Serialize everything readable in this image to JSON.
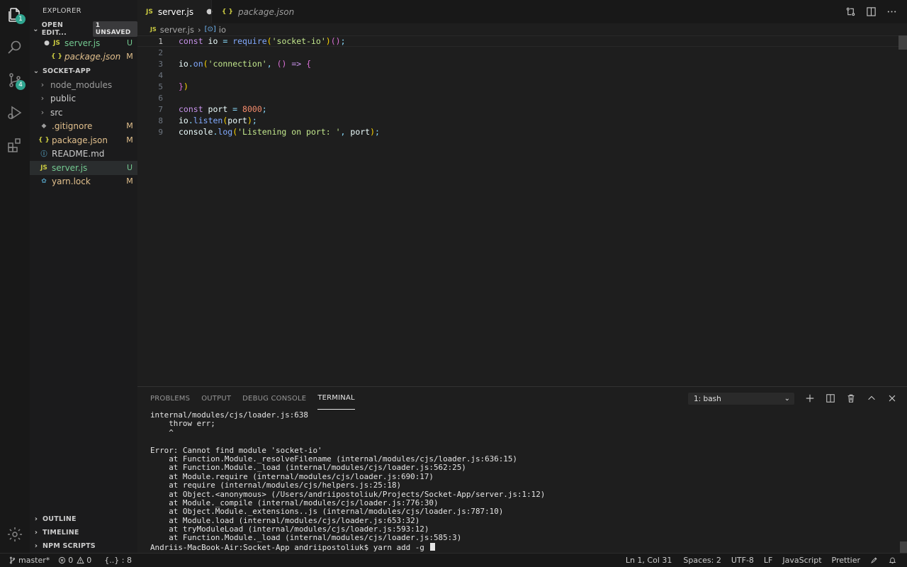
{
  "activity": {
    "explorer_badge": "1",
    "scm_badge": "4"
  },
  "sidebar": {
    "title": "EXPLORER",
    "open_editors": {
      "label": "OPEN EDIT...",
      "unsaved": "1 UNSAVED",
      "items": [
        {
          "icon": "JS",
          "name": "server.js",
          "status": "U"
        },
        {
          "icon": "{ }",
          "name": "package.json",
          "status": "M"
        }
      ]
    },
    "project": {
      "label": "SOCKET-APP",
      "items": [
        {
          "name": "node_modules",
          "status": ""
        },
        {
          "name": "public",
          "status": ""
        },
        {
          "name": "src",
          "status": ""
        },
        {
          "name": ".gitignore",
          "status": "M"
        },
        {
          "name": "package.json",
          "status": "M"
        },
        {
          "name": "README.md",
          "status": ""
        },
        {
          "name": "server.js",
          "status": "U"
        },
        {
          "name": "yarn.lock",
          "status": "M"
        }
      ]
    },
    "outline": "OUTLINE",
    "timeline": "TIMELINE",
    "npm_scripts": "NPM SCRIPTS"
  },
  "tabs": [
    {
      "icon": "JS",
      "label": "server.js"
    },
    {
      "icon": "{ }",
      "label": "package.json"
    }
  ],
  "breadcrumb": {
    "icon": "JS",
    "file": "server.js",
    "separator": "›",
    "symbol": "io"
  },
  "editor": {
    "line_numbers": [
      "1",
      "2",
      "3",
      "4",
      "5",
      "6",
      "7",
      "8",
      "9"
    ],
    "lines": [
      [
        [
          "kw2",
          "const"
        ],
        [
          "var",
          " io "
        ],
        [
          "pun",
          "="
        ],
        [
          "var",
          " "
        ],
        [
          "fn",
          "require"
        ],
        [
          "br1",
          "("
        ],
        [
          "str",
          "'socket-io'"
        ],
        [
          "br1",
          ")"
        ],
        [
          "br2",
          "("
        ],
        [
          "br2",
          ")"
        ],
        [
          "pun",
          ";"
        ]
      ],
      [],
      [
        [
          "var",
          "io"
        ],
        [
          "pun",
          "."
        ],
        [
          "fn",
          "on"
        ],
        [
          "br1",
          "("
        ],
        [
          "str",
          "'connection'"
        ],
        [
          "pun",
          ","
        ],
        [
          "var",
          " "
        ],
        [
          "br2",
          "()"
        ],
        [
          "var",
          " "
        ],
        [
          "kw2",
          "=>"
        ],
        [
          "var",
          " "
        ],
        [
          "br2",
          "{"
        ]
      ],
      [],
      [
        [
          "br2",
          "}"
        ],
        [
          "br1",
          ")"
        ]
      ],
      [],
      [
        [
          "kw2",
          "const"
        ],
        [
          "var",
          " port "
        ],
        [
          "pun",
          "="
        ],
        [
          "var",
          " "
        ],
        [
          "num",
          "8000"
        ],
        [
          "pun",
          ";"
        ]
      ],
      [
        [
          "var",
          "io"
        ],
        [
          "pun",
          "."
        ],
        [
          "fn",
          "listen"
        ],
        [
          "br1",
          "("
        ],
        [
          "var",
          "port"
        ],
        [
          "br1",
          ")"
        ],
        [
          "pun",
          ";"
        ]
      ],
      [
        [
          "var",
          "console"
        ],
        [
          "pun",
          "."
        ],
        [
          "fn",
          "log"
        ],
        [
          "br1",
          "("
        ],
        [
          "str",
          "'Listening on port: '"
        ],
        [
          "pun",
          ","
        ],
        [
          "var",
          " port"
        ],
        [
          "br1",
          ")"
        ],
        [
          "pun",
          ";"
        ]
      ]
    ]
  },
  "panel": {
    "tabs": [
      "PROBLEMS",
      "OUTPUT",
      "DEBUG CONSOLE",
      "TERMINAL"
    ],
    "terminal_select": "1: bash",
    "terminal_lines": [
      "internal/modules/cjs/loader.js:638",
      "    throw err;",
      "    ^",
      "",
      "Error: Cannot find module 'socket-io'",
      "    at Function.Module._resolveFilename (internal/modules/cjs/loader.js:636:15)",
      "    at Function.Module._load (internal/modules/cjs/loader.js:562:25)",
      "    at Module.require (internal/modules/cjs/loader.js:690:17)",
      "    at require (internal/modules/cjs/helpers.js:25:18)",
      "    at Object.<anonymous> (/Users/andriipostoliuk/Projects/Socket-App/server.js:1:12)",
      "    at Module._compile (internal/modules/cjs/loader.js:776:30)",
      "    at Object.Module._extensions..js (internal/modules/cjs/loader.js:787:10)",
      "    at Module.load (internal/modules/cjs/loader.js:653:32)",
      "    at tryModuleLoad (internal/modules/cjs/loader.js:593:12)",
      "    at Function.Module._load (internal/modules/cjs/loader.js:585:3)"
    ],
    "prompt": "Andriis-MacBook-Air:Socket-App andriipostoliuk$ yarn add -g "
  },
  "status": {
    "branch": "master*",
    "errors": "0",
    "warnings": "0",
    "json_scope": "{..} : 8",
    "position": "Ln 1, Col 31",
    "spaces": "Spaces: 2",
    "encoding": "UTF-8",
    "eol": "LF",
    "language": "JavaScript",
    "formatter": "Prettier"
  }
}
